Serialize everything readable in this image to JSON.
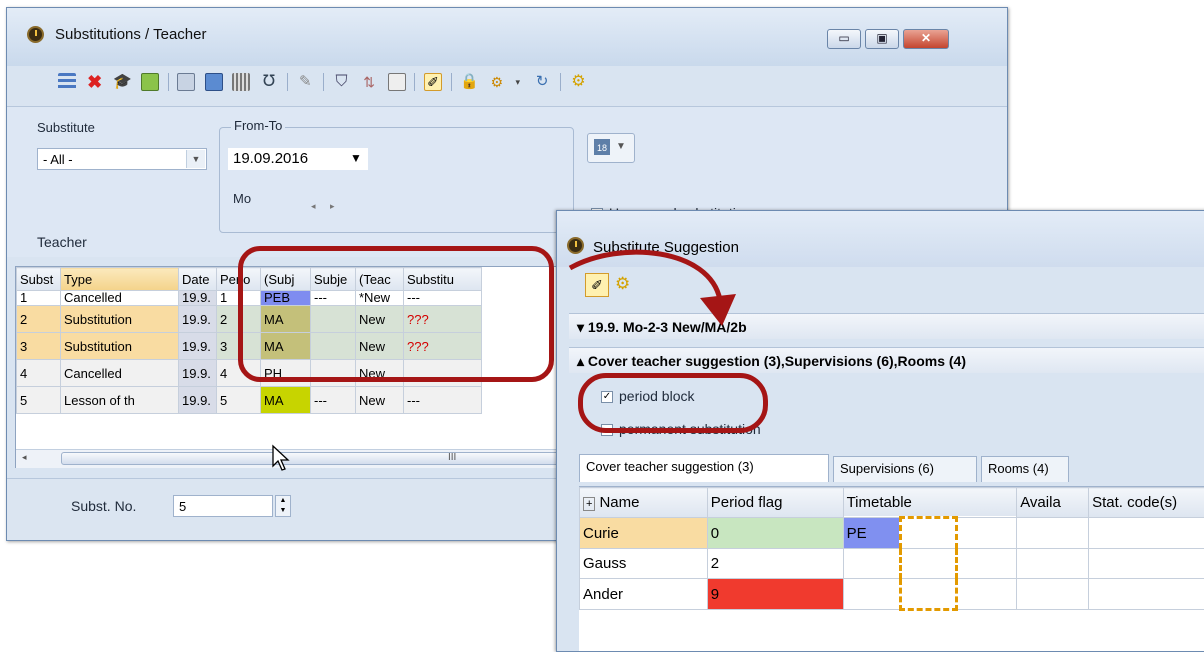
{
  "main_window": {
    "title": "Substitutions / Teacher",
    "controls": [
      "▭",
      "▣",
      "✕"
    ],
    "filter": {
      "substitute_label": "Substitute",
      "substitute_value": "- All -",
      "from_to_label": "From-To",
      "date_value": "19.09.2016",
      "weekday": "Mo",
      "uncovered_label": "Uncovered substitutions",
      "teacher_label": "Teacher"
    },
    "grid": {
      "headers": [
        "Subst",
        "Type",
        "Date",
        "Perio",
        "(Subj",
        "Subje",
        "(Teac",
        "Substitu"
      ],
      "rows": [
        {
          "subst": "1",
          "type": "Cancelled",
          "date": "19.9.",
          "period": "1",
          "subj_old": "PEB",
          "subj": "---",
          "teacher_old": "*New",
          "substitute": "---"
        },
        {
          "subst": "2",
          "type": "Substitution",
          "date": "19.9.",
          "period": "2",
          "subj_old": "MA",
          "subj": "",
          "teacher_old": "New",
          "substitute": "???"
        },
        {
          "subst": "3",
          "type": "Substitution",
          "date": "19.9.",
          "period": "3",
          "subj_old": "MA",
          "subj": "",
          "teacher_old": "New",
          "substitute": "???"
        },
        {
          "subst": "4",
          "type": "Cancelled",
          "date": "19.9.",
          "period": "4",
          "subj_old": "PH",
          "subj": "",
          "teacher_old": "New",
          "substitute": ""
        },
        {
          "subst": "5",
          "type": "Lesson of th",
          "date": "19.9.",
          "period": "5",
          "subj_old": "MA",
          "subj": "---",
          "teacher_old": "New",
          "substitute": "---"
        }
      ],
      "scroll_marker": "III"
    },
    "status": {
      "subst_no_label": "Subst. No.",
      "subst_no_value": "5"
    }
  },
  "suggestion_window": {
    "title": "Substitute Suggestion",
    "section_lesson": "19.9. Mo-2-3 New/MA/2b",
    "section_cover": "Cover teacher suggestion (3),Supervisions (6),Rooms (4)",
    "period_block_label": "period block",
    "period_block_checked": true,
    "permanent_label": "permanent substitution",
    "tabs": [
      "Cover teacher suggestion (3)",
      "Supervisions (6)",
      "Rooms (4)"
    ],
    "grid": {
      "headers": [
        "Name",
        "Period flag",
        "Timetable",
        "Availa",
        "Stat. code(s)"
      ],
      "rows": [
        {
          "name": "Curie",
          "flag": "0",
          "timetable": "PE",
          "flag_color": "#c8e6c0"
        },
        {
          "name": "Gauss",
          "flag": "2",
          "timetable": "",
          "flag_color": "#ffffff"
        },
        {
          "name": "Ander",
          "flag": "9",
          "timetable": "",
          "flag_color": "#f03a2e"
        }
      ]
    }
  },
  "colors": {
    "highlight": "#a51515",
    "subject_olive": "#c4c07a",
    "subject_lime": "#c7d400",
    "subject_blue": "#7f8cf0",
    "selected_row": "#f9dca2"
  }
}
